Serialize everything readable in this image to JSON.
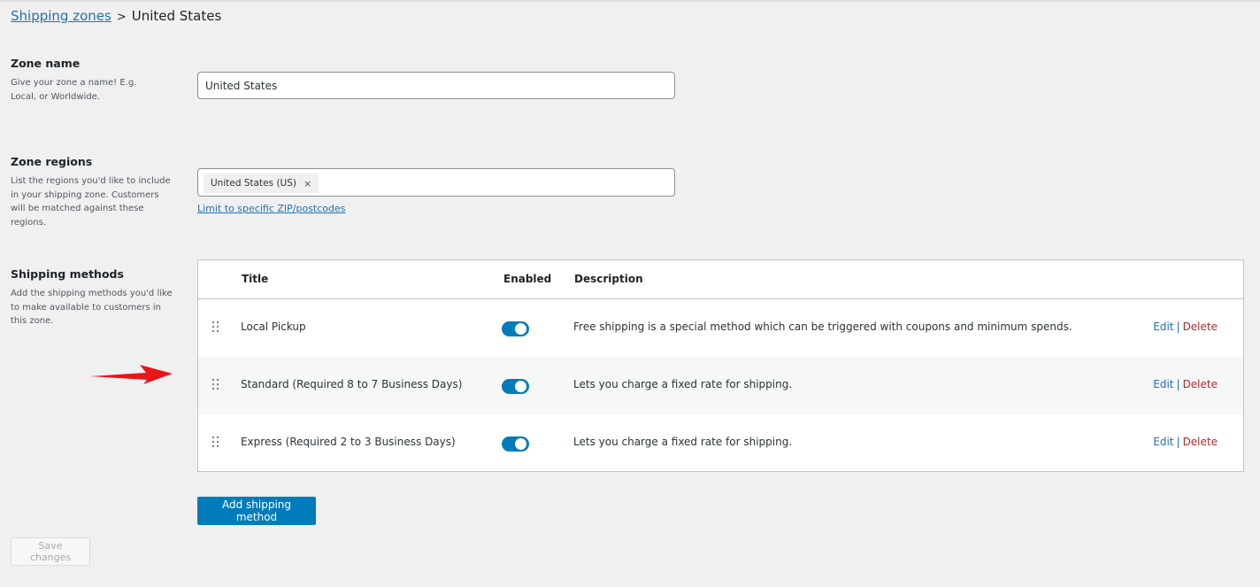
{
  "breadcrumb": {
    "parent_label": "Shipping zones",
    "separator": ">",
    "current": "United States"
  },
  "zone_name": {
    "heading": "Zone name",
    "help": "Give your zone a name! E.g. Local, or Worldwide.",
    "value": "United States"
  },
  "zone_regions": {
    "heading": "Zone regions",
    "help": "List the regions you'd like to include in your shipping zone. Customers will be matched against these regions.",
    "selected": [
      {
        "label": "United States (US)",
        "remove_glyph": "×"
      }
    ],
    "limit_link": "Limit to specific ZIP/postcodes"
  },
  "shipping_methods": {
    "heading": "Shipping methods",
    "help": "Add the shipping methods you'd like to make available to customers in this zone.",
    "columns": {
      "title": "Title",
      "enabled": "Enabled",
      "description": "Description"
    },
    "rows": [
      {
        "title": "Local Pickup",
        "enabled": true,
        "description": "Free shipping is a special method which can be triggered with coupons and minimum spends.",
        "edit": "Edit",
        "delete": "Delete"
      },
      {
        "title": "Standard (Required 8 to 7 Business Days)",
        "enabled": true,
        "description": "Lets you charge a fixed rate for shipping.",
        "edit": "Edit",
        "delete": "Delete"
      },
      {
        "title": "Express (Required 2 to 3 Business Days)",
        "enabled": true,
        "description": "Lets you charge a fixed rate for shipping.",
        "edit": "Edit",
        "delete": "Delete"
      }
    ],
    "action_separator": "|",
    "add_button": "Add shipping method"
  },
  "save_button": "Save changes",
  "colors": {
    "accent": "#007cba",
    "link": "#2271b1",
    "delete": "#b32d2e",
    "annotation_arrow": "#e8161b"
  }
}
